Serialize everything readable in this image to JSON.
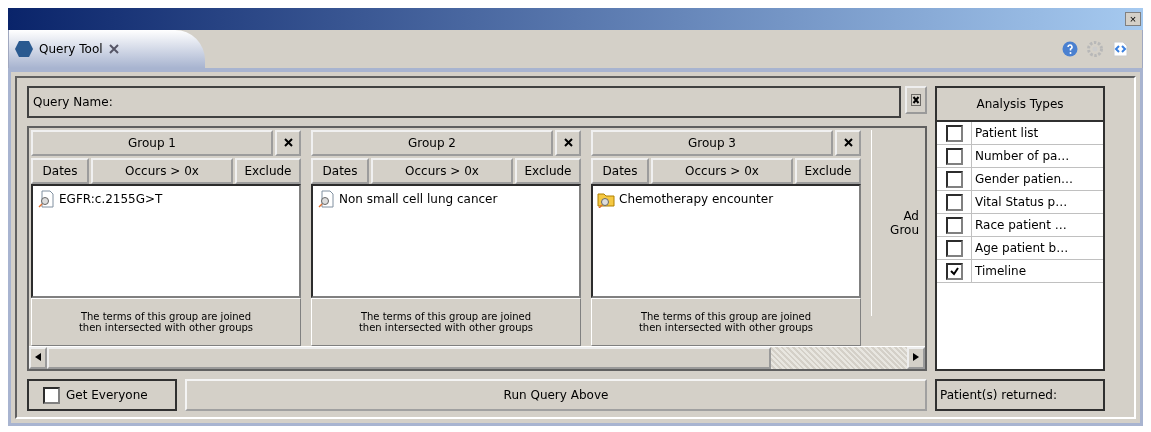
{
  "window": {
    "title_bar_close": "×"
  },
  "tab": {
    "label": "Query Tool",
    "selected": true
  },
  "query_name": {
    "label": "Query Name:"
  },
  "groups": [
    {
      "title": "Group 1",
      "dates": "Dates",
      "occurs": "Occurs > 0x",
      "exclude": "Exclude",
      "terms": [
        {
          "label": "EGFR:c.2155G>T",
          "kind": "term"
        }
      ],
      "footer": "The terms of this group are joined then intersected with other groups"
    },
    {
      "title": "Group 2",
      "dates": "Dates",
      "occurs": "Occurs > 0x",
      "exclude": "Exclude",
      "terms": [
        {
          "label": "Non small cell lung cancer",
          "kind": "term"
        }
      ],
      "footer": "The terms of this group are joined then intersected with other groups"
    },
    {
      "title": "Group 3",
      "dates": "Dates",
      "occurs": "Occurs > 0x",
      "exclude": "Exclude",
      "terms": [
        {
          "label": "Chemotherapy encounter",
          "kind": "folder"
        }
      ],
      "footer": "The terms of this group are joined then intersected with other groups"
    }
  ],
  "add_group": [
    "Ad",
    "Grou"
  ],
  "analysis_types": {
    "title": "Analysis Types",
    "items": [
      {
        "label": "Patient list",
        "checked": false
      },
      {
        "label": "Number of pa…",
        "checked": false
      },
      {
        "label": "Gender patien…",
        "checked": false
      },
      {
        "label": "Vital Status p…",
        "checked": false
      },
      {
        "label": "Race patient …",
        "checked": false
      },
      {
        "label": "Age patient b…",
        "checked": false
      },
      {
        "label": "Timeline",
        "checked": true
      }
    ]
  },
  "get_everyone": {
    "label": "Get Everyone",
    "checked": false
  },
  "run_button": "Run Query Above",
  "status": "Patient(s) returned:"
}
